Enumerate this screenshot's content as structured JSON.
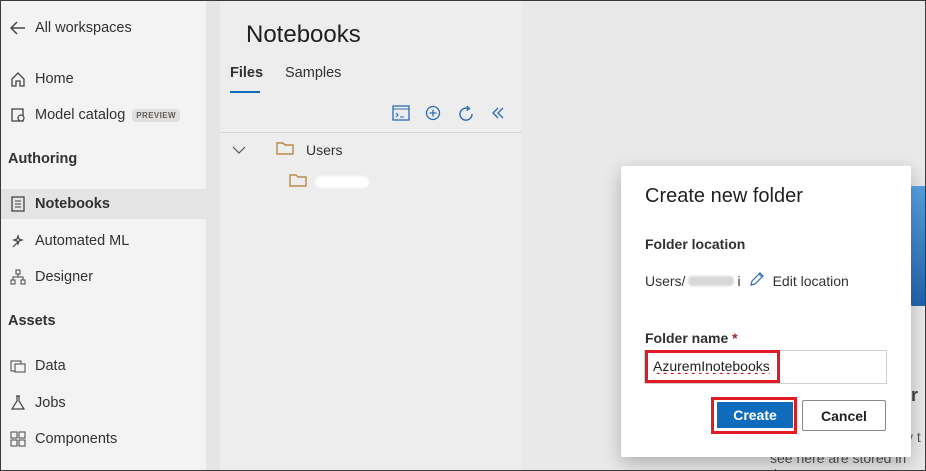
{
  "nav": {
    "back_label": "All workspaces",
    "items": [
      {
        "label": "Home",
        "icon": "home-icon"
      },
      {
        "label": "Model catalog",
        "icon": "model-catalog-icon",
        "badge": "PREVIEW"
      }
    ],
    "authoring_heading": "Authoring",
    "authoring_items": [
      {
        "label": "Notebooks",
        "icon": "notebook-icon"
      },
      {
        "label": "Automated ML",
        "icon": "automl-icon"
      },
      {
        "label": "Designer",
        "icon": "designer-icon"
      }
    ],
    "assets_heading": "Assets",
    "assets_items": [
      {
        "label": "Data",
        "icon": "data-icon"
      },
      {
        "label": "Jobs",
        "icon": "jobs-icon"
      },
      {
        "label": "Components",
        "icon": "components-icon"
      }
    ]
  },
  "notebooks": {
    "title": "Notebooks",
    "tabs": [
      "Files",
      "Samples"
    ],
    "tree": {
      "root": "Users"
    }
  },
  "main_bg": {
    "fragment1": "ur",
    "fragment2": "y t",
    "fragment3": "see here are stored in the"
  },
  "dialog": {
    "title": "Create new folder",
    "location_label": "Folder location",
    "location_prefix": "Users/",
    "location_suffix": "i",
    "edit_location": "Edit location",
    "name_label": "Folder name",
    "required_mark": "*",
    "name_value": "AzuremInotebooks",
    "create_label": "Create",
    "cancel_label": "Cancel"
  },
  "colors": {
    "accent": "#0f6cbd",
    "highlight": "#e01b24"
  }
}
